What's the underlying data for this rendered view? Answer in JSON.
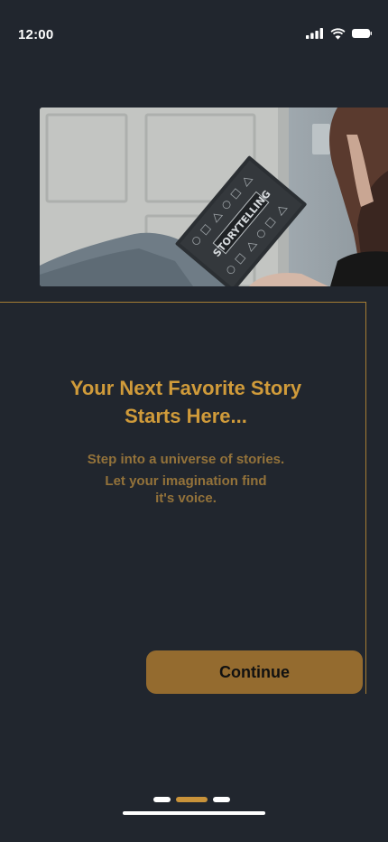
{
  "status_bar": {
    "time": "12:00",
    "icons": [
      "cellular-signal-icon",
      "wifi-icon",
      "battery-icon"
    ]
  },
  "hero_image": {
    "subject": "storytelling-book-photo",
    "book_cover_text": "STORYTELLING"
  },
  "onboarding": {
    "headline_line1": "Your Next Favorite Story",
    "headline_line2": "Starts Here...",
    "subtext_line1": "Step into a universe of stories.",
    "subtext_line2": "Let your imagination find",
    "subtext_line3": "it's voice.",
    "continue_label": "Continue"
  },
  "pager": {
    "total": 3,
    "active_index": 1
  },
  "colors": {
    "background": "#21262e",
    "accent": "#d09b3a",
    "subtext": "#93723a",
    "button": "#946b2f",
    "frame": "#a57d34"
  }
}
